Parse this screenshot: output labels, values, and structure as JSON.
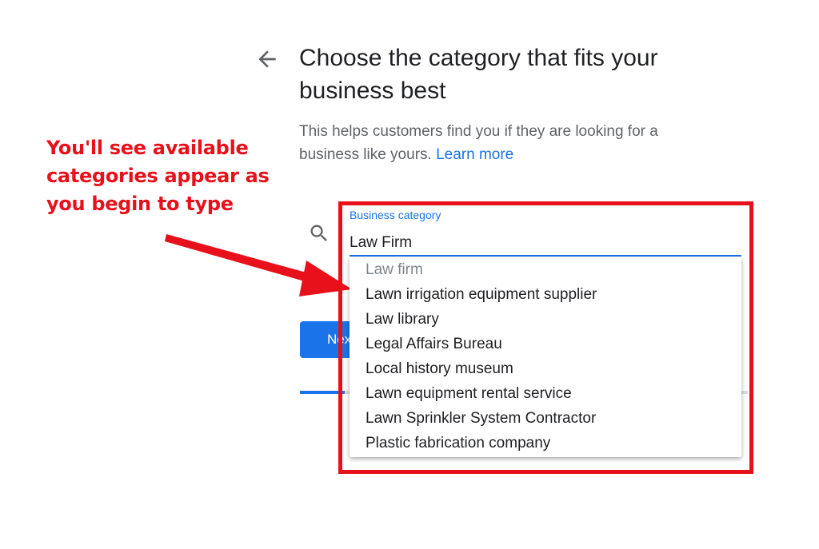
{
  "header": {
    "back_icon": "arrow-left-icon",
    "title": "Choose the category that fits your business best",
    "subtitle": "This helps customers find you if they are looking for a business like yours.",
    "learn_more": "Learn more"
  },
  "annotation": {
    "text": "You'll see available categories appear as you begin to type",
    "color": "#e8101a"
  },
  "search": {
    "icon": "search-icon",
    "label": "Business category",
    "value": "Law Firm"
  },
  "suggestions": [
    "Law firm",
    "Lawn irrigation equipment supplier",
    "Law library",
    "Legal Affairs Bureau",
    "Local history museum",
    "Lawn equipment rental service",
    "Lawn Sprinkler System Contractor",
    "Plastic fabrication company"
  ],
  "next_button": {
    "label": "Next"
  },
  "progress": {
    "fraction": 0.1
  },
  "colors": {
    "accent": "#1a73e8",
    "annotation": "#e8101a",
    "text": "#202124",
    "muted": "#5f6368"
  }
}
